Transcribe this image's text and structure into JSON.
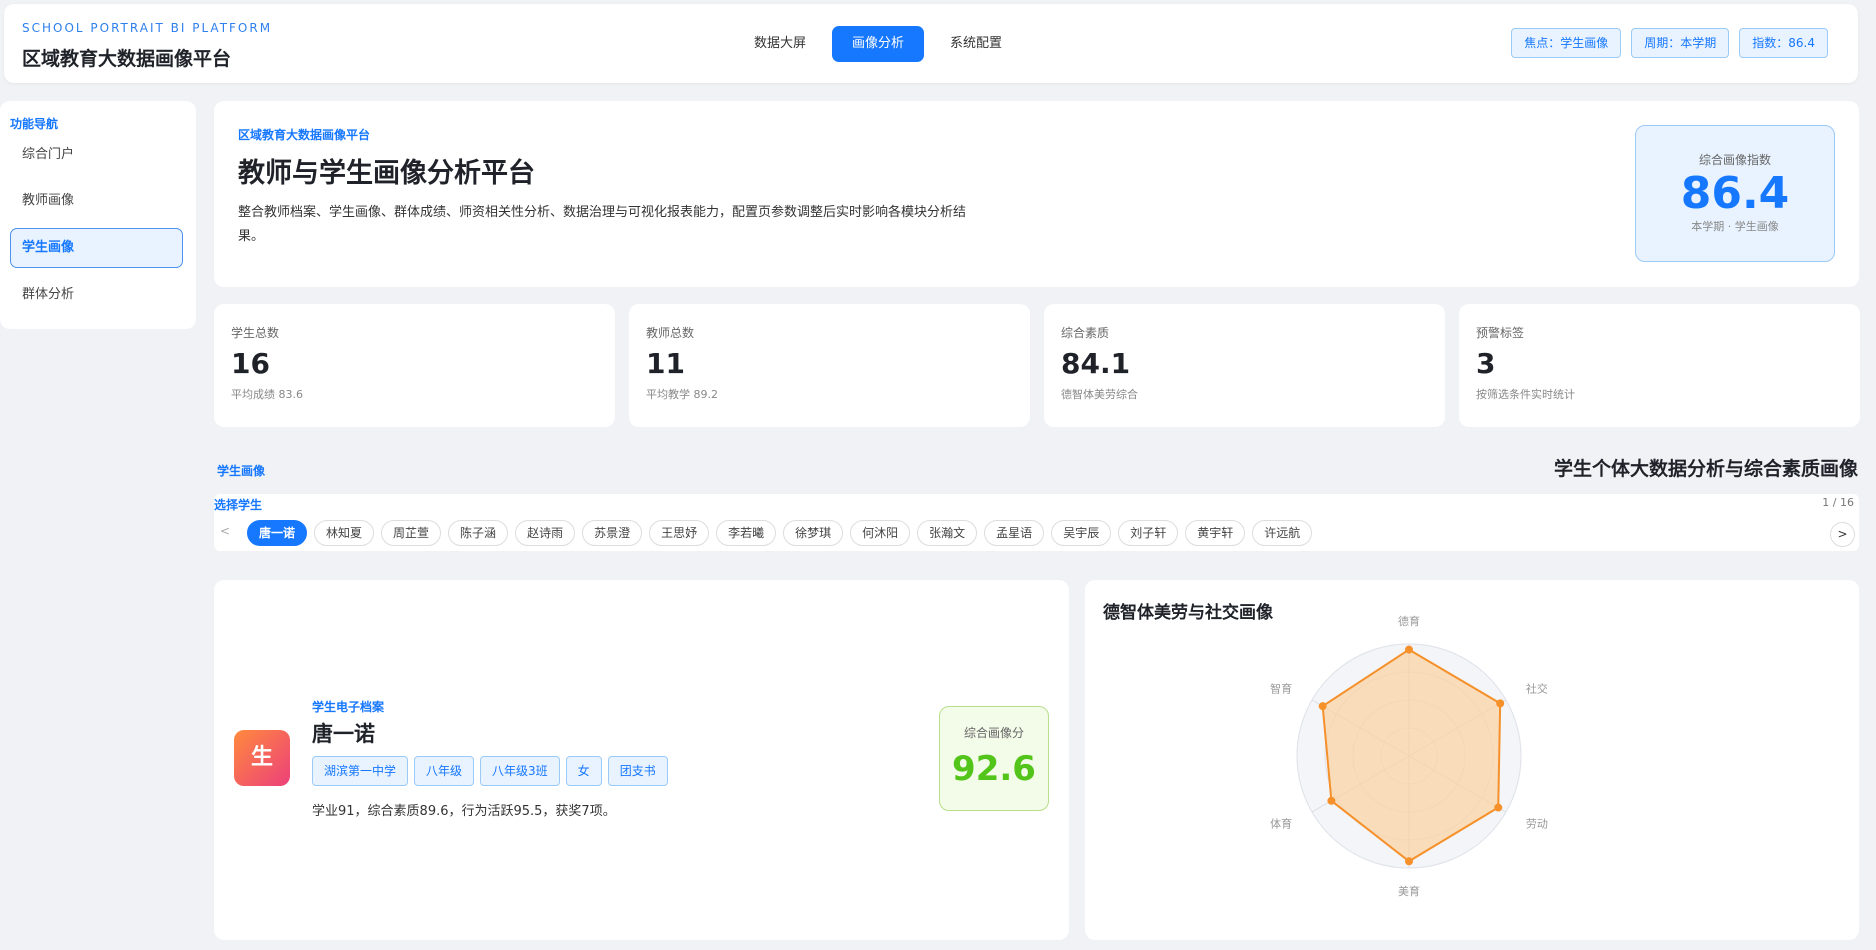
{
  "header": {
    "brand_en": "SCHOOL PORTRAIT BI PLATFORM",
    "brand_title": "区域教育大数据画像平台",
    "nav": [
      {
        "label": "数据大屏"
      },
      {
        "label": "画像分析",
        "active": true
      },
      {
        "label": "系统配置"
      }
    ],
    "chips": {
      "focus": "焦点：学生画像",
      "period": "周期：本学期",
      "index": "指数：86.4"
    }
  },
  "sidebar": {
    "title": "功能导航",
    "items": [
      {
        "label": "综合门户"
      },
      {
        "label": "教师画像"
      },
      {
        "label": "学生画像",
        "active": true
      },
      {
        "label": "群体分析"
      }
    ]
  },
  "hero": {
    "kicker": "区域教育大数据画像平台",
    "title": "教师与学生画像分析平台",
    "desc": "整合教师档案、学生画像、群体成绩、师资相关性分析、数据治理与可视化报表能力，配置页参数调整后实时影响各模块分析结果。",
    "index_label": "综合画像指数",
    "index_value": "86.4",
    "index_sub": "本学期 · 学生画像"
  },
  "stats": [
    {
      "label": "学生总数",
      "value": "16",
      "note": "平均成绩 83.6"
    },
    {
      "label": "教师总数",
      "value": "11",
      "note": "平均教学 89.2"
    },
    {
      "label": "综合素质",
      "value": "84.1",
      "note": "德智体美劳综合"
    },
    {
      "label": "预警标签",
      "value": "3",
      "note": "按筛选条件实时统计"
    }
  ],
  "section": {
    "tag": "学生画像",
    "title": "学生个体大数据分析与综合素质画像"
  },
  "selector": {
    "label": "选择学生",
    "count": "1 / 16",
    "prev": "<",
    "next": ">",
    "students": [
      "唐一诺",
      "林知夏",
      "周芷萱",
      "陈子涵",
      "赵诗雨",
      "苏景澄",
      "王思妤",
      "李若曦",
      "徐梦琪",
      "何沐阳",
      "张瀚文",
      "孟星语",
      "吴宇辰",
      "刘子轩",
      "黄宇轩",
      "许远航"
    ],
    "active_index": 0
  },
  "profile": {
    "avatar_char": "生",
    "kicker": "学生电子档案",
    "name": "唐一诺",
    "tags": [
      "湖滨第一中学",
      "八年级",
      "八年级3班",
      "女",
      "团支书"
    ],
    "summary": "学业91，综合素质89.6，行为活跃95.5，获奖7项。",
    "score_label": "综合画像分",
    "score_value": "92.6"
  },
  "chart_data": {
    "type": "radar",
    "title": "德智体美劳与社交画像",
    "axes": [
      "德育",
      "社交",
      "劳动",
      "美育",
      "体育",
      "智育"
    ],
    "values": [
      95,
      94,
      92,
      94,
      80,
      89
    ],
    "rmax": 100,
    "rings": 4,
    "series_color": "#f5902b",
    "fill_color": "#fbd3a6"
  }
}
